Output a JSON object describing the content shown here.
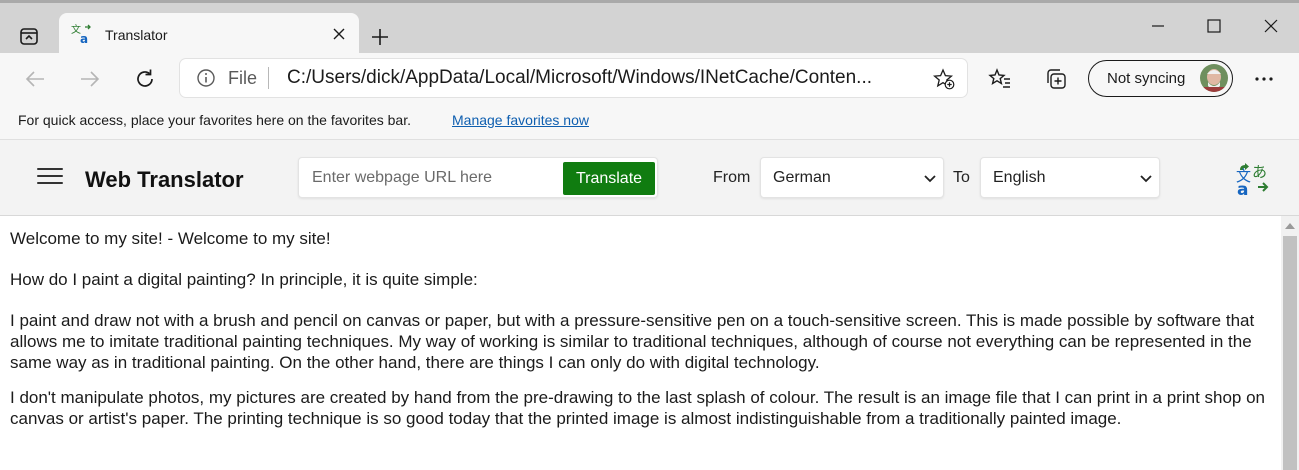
{
  "browser": {
    "tab": {
      "title": "Translator"
    },
    "address": {
      "scheme_label": "File",
      "url": "C:/Users/dick/AppData/Local/Microsoft/Windows/INetCache/Conten..."
    },
    "profile": {
      "sync_label": "Not syncing"
    },
    "favorites_bar": {
      "text": "For quick access, place your favorites here on the favorites bar.",
      "link": "Manage favorites now"
    }
  },
  "app": {
    "title": "Web Translator",
    "url_input": {
      "placeholder": "Enter webpage URL here",
      "value": ""
    },
    "translate_label": "Translate",
    "from_label": "From",
    "from_value": "German",
    "to_label": "To",
    "to_value": "English",
    "accent_color": "#107c10"
  },
  "page": {
    "paragraphs": [
      "Welcome to my site! - Welcome to my site!",
      "How do I paint a digital painting? In principle, it is quite simple:",
      "I paint and draw not with a brush and pencil on canvas or paper, but with a pressure-sensitive pen on a touch-sensitive screen. This is made possible by software that allows me to imitate traditional painting techniques. My way of working is similar to traditional techniques, although of course not everything can be represented in the same way as in traditional painting. On the other hand, there are things I can only do with digital technology.",
      "I don't manipulate photos, my pictures are created by hand from the pre-drawing to the last splash of colour. The result is an image file that I can print in a print shop on canvas or artist's paper. The printing technique is so good today that the printed image is almost indistinguishable from a traditionally painted image."
    ]
  }
}
